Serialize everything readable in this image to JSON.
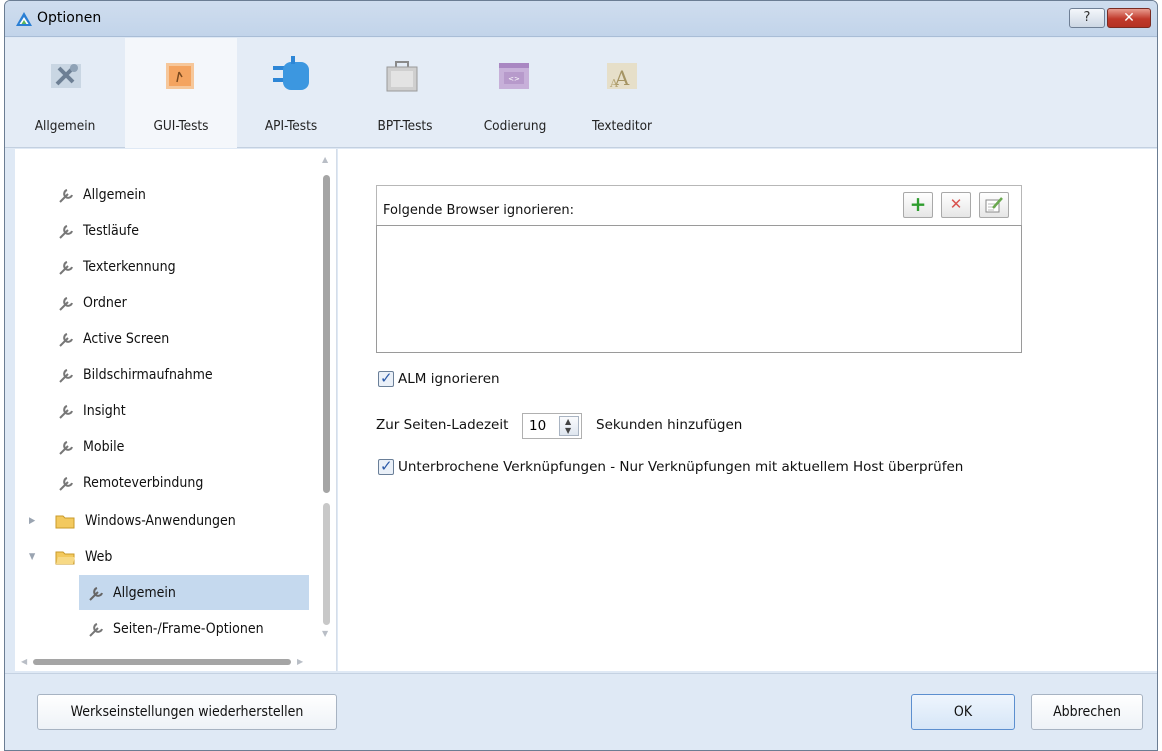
{
  "window": {
    "title": "Optionen",
    "help_label": "?",
    "close_label": "✕"
  },
  "toolbar": {
    "items": [
      {
        "label": "Allgemein",
        "icon": "tools-icon"
      },
      {
        "label": "GUI-Tests",
        "icon": "gui-tests-icon"
      },
      {
        "label": "API-Tests",
        "icon": "api-tests-icon"
      },
      {
        "label": "BPT-Tests",
        "icon": "briefcase-icon"
      },
      {
        "label": "Codierung",
        "icon": "code-window-icon"
      },
      {
        "label": "Texteditor",
        "icon": "text-editor-icon"
      }
    ],
    "selected": "GUI-Tests"
  },
  "nav": {
    "items": [
      {
        "label": "Allgemein"
      },
      {
        "label": "Testläufe"
      },
      {
        "label": "Texterkennung"
      },
      {
        "label": "Ordner"
      },
      {
        "label": "Active Screen"
      },
      {
        "label": "Bildschirmaufnahme"
      },
      {
        "label": "Insight"
      },
      {
        "label": "Mobile"
      },
      {
        "label": "Remoteverbindung"
      },
      {
        "label": "Windows-Anwendungen"
      },
      {
        "label": "Web"
      },
      {
        "label": "Allgemein"
      },
      {
        "label": "Seiten-/Frame-Optionen"
      }
    ],
    "selected": "Web > Allgemein"
  },
  "main": {
    "ignore_browsers_label": "Folgende Browser ignorieren:",
    "add_label": "+",
    "delete_label": "✕",
    "alm_ignore_label": "ALM ignorieren",
    "load_time_prefix": "Zur Seiten-Ladezeit",
    "load_time_value": "10",
    "load_time_suffix": "Sekunden hinzufügen",
    "broken_links_label": "Unterbrochene Verknüpfungen - Nur Verknüpfungen mit aktuellem Host überprüfen",
    "alm_checked": true,
    "broken_links_checked": true
  },
  "footer": {
    "reset_label": "Werkseinstellungen wiederherstellen",
    "ok_label": "OK",
    "cancel_label": "Abbrechen"
  },
  "colors": {
    "accent": "#c5d9ee",
    "close": "#c0392b",
    "add": "#2e9d2e",
    "delete": "#d9534f"
  }
}
